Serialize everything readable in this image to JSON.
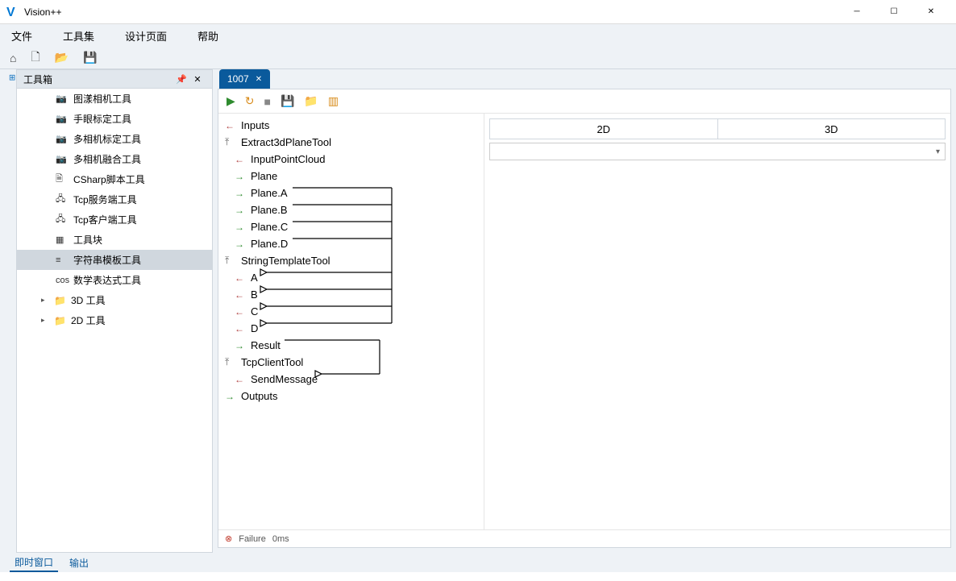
{
  "app": {
    "title": "Vision++"
  },
  "menu": {
    "file": "文件",
    "toolset": "工具集",
    "design": "设计页面",
    "help": "帮助"
  },
  "toolbox": {
    "title": "工具箱",
    "items": [
      {
        "label": "图漾相机工具",
        "icon": "camera"
      },
      {
        "label": "手眼标定工具",
        "icon": "camera"
      },
      {
        "label": "多相机标定工具",
        "icon": "camera"
      },
      {
        "label": "多相机融合工具",
        "icon": "camera"
      },
      {
        "label": "CSharp脚本工具",
        "icon": "script"
      },
      {
        "label": "Tcp服务端工具",
        "icon": "net"
      },
      {
        "label": "Tcp客户端工具",
        "icon": "net"
      },
      {
        "label": "工具块",
        "icon": "block"
      },
      {
        "label": "字符串模板工具",
        "icon": "string",
        "selected": true
      },
      {
        "label": "数学表达式工具",
        "icon": "cos"
      }
    ],
    "folders": [
      {
        "label": "3D 工具"
      },
      {
        "label": "2D 工具"
      }
    ]
  },
  "doc": {
    "tab": "1007",
    "tree": [
      {
        "arrow": "in",
        "depth": 1,
        "label": "Inputs"
      },
      {
        "arrow": "up",
        "depth": 1,
        "label": "Extract3dPlaneTool"
      },
      {
        "arrow": "in",
        "depth": 2,
        "label": "InputPointCloud"
      },
      {
        "arrow": "out",
        "depth": 2,
        "label": "Plane"
      },
      {
        "arrow": "out",
        "depth": 2,
        "label": "Plane.A"
      },
      {
        "arrow": "out",
        "depth": 2,
        "label": "Plane.B"
      },
      {
        "arrow": "out",
        "depth": 2,
        "label": "Plane.C"
      },
      {
        "arrow": "out",
        "depth": 2,
        "label": "Plane.D"
      },
      {
        "arrow": "up",
        "depth": 1,
        "label": "StringTemplateTool"
      },
      {
        "arrow": "in",
        "depth": 2,
        "label": "A"
      },
      {
        "arrow": "in",
        "depth": 2,
        "label": "B"
      },
      {
        "arrow": "in",
        "depth": 2,
        "label": "C"
      },
      {
        "arrow": "in",
        "depth": 2,
        "label": "D"
      },
      {
        "arrow": "out",
        "depth": 2,
        "label": "Result"
      },
      {
        "arrow": "up",
        "depth": 1,
        "label": "TcpClientTool"
      },
      {
        "arrow": "in",
        "depth": 2,
        "label": "SendMessage"
      },
      {
        "arrow": "out",
        "depth": 1,
        "label": "Outputs"
      }
    ],
    "viz": {
      "tab2d": "2D",
      "tab3d": "3D"
    },
    "status": {
      "text": "Failure",
      "time": "0ms"
    }
  },
  "bottom": {
    "immediate": "即时窗口",
    "output": "输出"
  }
}
